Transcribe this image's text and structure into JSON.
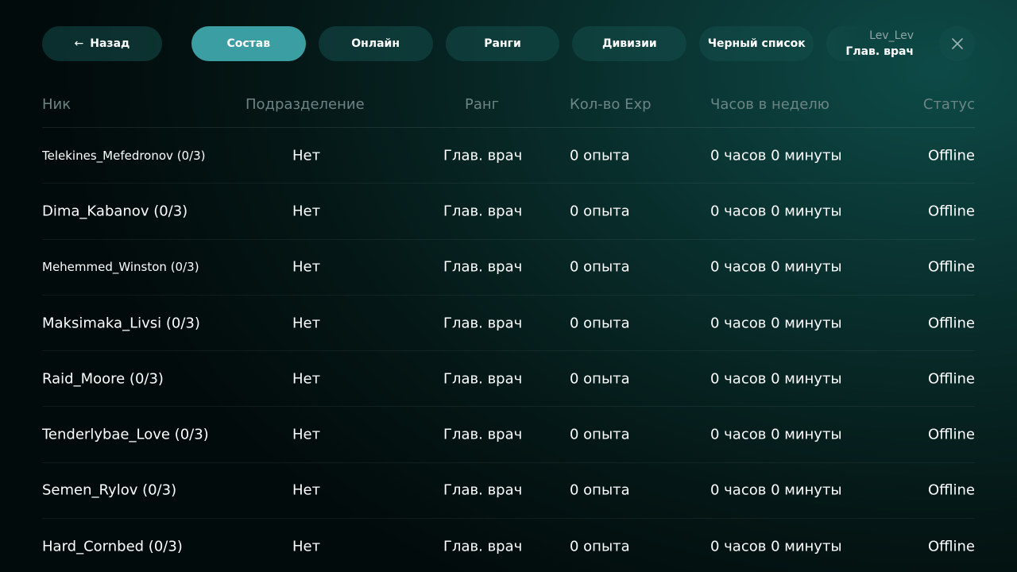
{
  "topbar": {
    "back_label": "Назад",
    "tabs": [
      {
        "label": "Состав",
        "active": true
      },
      {
        "label": "Онлайн",
        "active": false
      },
      {
        "label": "Ранги",
        "active": false
      },
      {
        "label": "Дивизии",
        "active": false
      },
      {
        "label": "Черный список",
        "active": false
      }
    ],
    "user": {
      "name": "Lev_Lev",
      "rank": "Глав. врач"
    }
  },
  "table": {
    "headers": {
      "nick": "Ник",
      "division": "Подразделение",
      "rank": "Ранг",
      "exp": "Кол-во Exp",
      "hours": "Часов в неделю",
      "status": "Статус"
    },
    "rows": [
      {
        "nick": "Telekines_Mefedronov (0/3)",
        "division": "Нет",
        "rank": "Глав. врач",
        "exp": "0 опыта",
        "hours": "0 часов 0 минуты",
        "status": "Offline"
      },
      {
        "nick": "Dima_Kabanov (0/3)",
        "division": "Нет",
        "rank": "Глав. врач",
        "exp": "0 опыта",
        "hours": "0 часов 0 минуты",
        "status": "Offline"
      },
      {
        "nick": "Mehemmed_Winston (0/3)",
        "division": "Нет",
        "rank": "Глав. врач",
        "exp": "0 опыта",
        "hours": "0 часов 0 минуты",
        "status": "Offline"
      },
      {
        "nick": "Maksimaka_Livsi (0/3)",
        "division": "Нет",
        "rank": "Глав. врач",
        "exp": "0 опыта",
        "hours": "0 часов 0 минуты",
        "status": "Offline"
      },
      {
        "nick": "Raid_Moore (0/3)",
        "division": "Нет",
        "rank": "Глав. врач",
        "exp": "0 опыта",
        "hours": "0 часов 0 минуты",
        "status": "Offline"
      },
      {
        "nick": "Tenderlybae_Love (0/3)",
        "division": "Нет",
        "rank": "Глав. врач",
        "exp": "0 опыта",
        "hours": "0 часов 0 минуты",
        "status": "Offline"
      },
      {
        "nick": "Semen_Rylov (0/3)",
        "division": "Нет",
        "rank": "Глав. врач",
        "exp": "0 опыта",
        "hours": "0 часов 0 минуты",
        "status": "Offline"
      },
      {
        "nick": "Hard_Cornbed (0/3)",
        "division": "Нет",
        "rank": "Глав. врач",
        "exp": "0 опыта",
        "hours": "0 часов 0 минуты",
        "status": "Offline"
      }
    ]
  },
  "colors": {
    "accent": "#3b9ea2",
    "button_bg": "#144e4c",
    "header_text": "#6c8584"
  },
  "icons": {
    "back": "arrow-left-icon",
    "close": "close-icon"
  }
}
